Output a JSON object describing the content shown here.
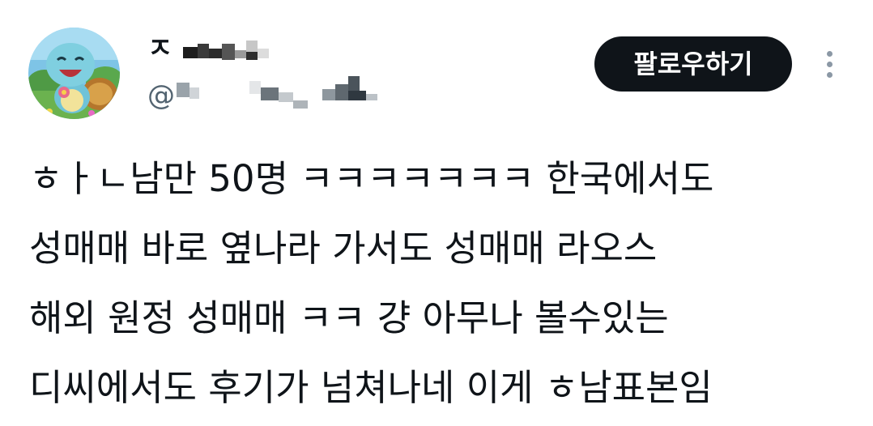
{
  "tweet": {
    "author": {
      "display_name": "ㅈ",
      "handle_prefix": "@"
    },
    "follow_label": "팔로우하기",
    "more_icon": "more-vertical-icon",
    "lines": [
      "ㅎㅏㄴ남만 50명 ㅋㅋㅋㅋㅋㅋㅋ 한국에서도",
      "성매매 바로 옆나라 가서도 성매매 라오스",
      "해외 원정 성매매 ㅋㅋ 걍 아무나 볼수있는",
      "디씨에서도 후기가 넘쳐나네 이게 ㅎ남표본임"
    ]
  },
  "colors": {
    "text": "#0f1419",
    "secondary_text": "#536471",
    "button_bg": "#0f1419",
    "button_text": "#ffffff",
    "more_icon": "#8b98a5"
  }
}
